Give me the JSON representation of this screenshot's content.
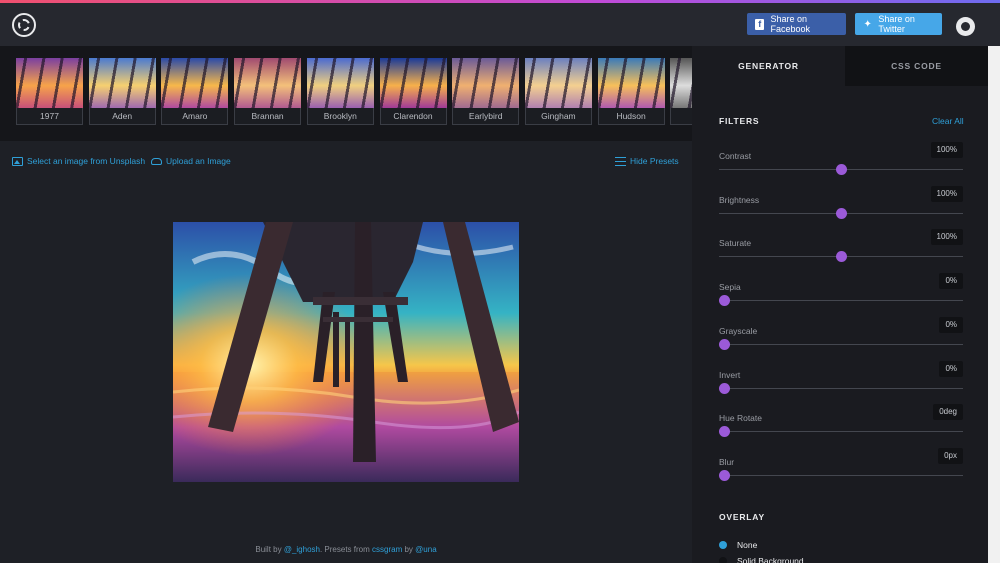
{
  "header": {
    "facebook_label": "Share on Facebook",
    "twitter_label": "Share on Twitter"
  },
  "presets": [
    "1977",
    "Aden",
    "Amaro",
    "Brannan",
    "Brooklyn",
    "Clarendon",
    "Earlybird",
    "Gingham",
    "Hudson",
    ""
  ],
  "toolbar": {
    "unsplash_label": "Select an image from Unsplash",
    "upload_label": "Upload an Image",
    "hide_presets_label": "Hide Presets"
  },
  "footer": {
    "built_by": "Built by",
    "author": "@_ighosh",
    "presets_from": ". Presets from",
    "cssgram": "cssgram",
    "by": "by",
    "una": "@una"
  },
  "panel": {
    "tab_generator": "GENERATOR",
    "tab_css": "CSS CODE",
    "filters_title": "FILTERS",
    "clear_all": "Clear All",
    "filters": [
      {
        "label": "Contrast",
        "value": "100%",
        "fraction": 0.5
      },
      {
        "label": "Brightness",
        "value": "100%",
        "fraction": 0.5
      },
      {
        "label": "Saturate",
        "value": "100%",
        "fraction": 0.5
      },
      {
        "label": "Sepia",
        "value": "0%",
        "fraction": 0
      },
      {
        "label": "Grayscale",
        "value": "0%",
        "fraction": 0
      },
      {
        "label": "Invert",
        "value": "0%",
        "fraction": 0
      },
      {
        "label": "Hue Rotate",
        "value": "0deg",
        "fraction": 0
      },
      {
        "label": "Blur",
        "value": "0px",
        "fraction": 0
      }
    ],
    "overlay_title": "OVERLAY",
    "overlay_options": [
      {
        "label": "None",
        "selected": true
      },
      {
        "label": "Solid Background",
        "selected": false
      }
    ]
  },
  "colors": {
    "accent": "#2fa0d8",
    "slider_thumb": "#9b5ad8",
    "facebook": "#3b5fa8",
    "twitter": "#46a7e8"
  }
}
